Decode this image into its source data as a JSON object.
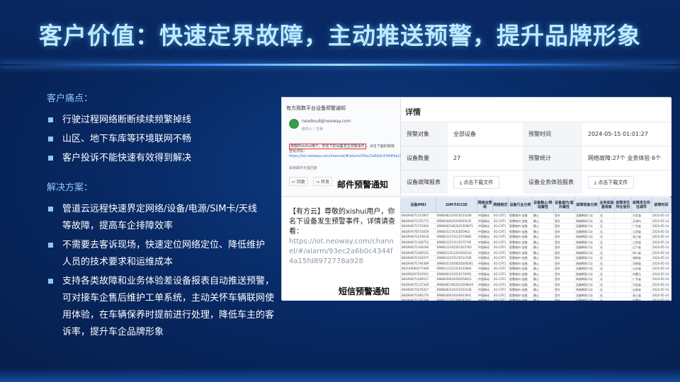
{
  "slide": {
    "title": "客户价值：快速定界故障，主动推送预警，提升品牌形象"
  },
  "pain_points": {
    "heading": "客户痛点：",
    "items": [
      {
        "text": "行驶过程网络断断续续频繁掉线"
      },
      {
        "text": "山区、地下车库等环境联网不畅"
      },
      {
        "text": "客户投诉不能快速有效得到解决"
      }
    ]
  },
  "solutions": {
    "heading": "解决方案：",
    "items": [
      {
        "text": "管道云远程快速界定网络/设备/电源/SIM卡/天线",
        "cont": "等故障，提高车企排障效率"
      },
      {
        "text": "不需要去客诉现场，快速定位网络定位、降低维护",
        "cont": "人员的技术要求和运维成本"
      },
      {
        "text": "支持各类故障和业务体验差设备报表自动推送预警，",
        "cont": "可对接车企售后维护工单系统，主动关怀车辆联网使用体验，在车辆保养时提前进行处理，降低车主的客诉率，提升车企品牌形象"
      }
    ]
  },
  "figure": {
    "email": {
      "title": "有方观数平台设备预警通知",
      "from": "neodoud@neoway.com",
      "to": "收件人：王伊",
      "highlight": "尊敬的xishui用户，你名下的设备发生预警事件",
      "body_rest": "，点击下面的链接查看详情：",
      "link": "https://iot.neoway.com/channel/#/alarm/93ec2a6b0c4344f4a15fd8972778a928",
      "footer": "系统邮件无需回复",
      "btn_reply": "回复",
      "btn_forward": "转发",
      "caption": "邮件预警通知"
    },
    "details": {
      "title": "详情",
      "rows": [
        {
          "l1": "预警对象",
          "v1": "全部设备",
          "l2": "预警时间",
          "v2": "2024-05-15 01:01:27"
        },
        {
          "l1": "设备数量",
          "v1": "27",
          "l2": "预警统计",
          "v2": "网络故障:27个  业务体验 6个"
        },
        {
          "l1": "设备故障报表",
          "v1": "点击下载文件",
          "l2": "设备业务体验报表",
          "v2": "点击下载文件"
        }
      ]
    },
    "sms": {
      "text": "【有方云】尊敬的xishui用户，你名下设备发生预警事件，详情请查看：",
      "link": "https://iot.neoway.com/channel/#/alarm/93ec2a6b0c4344f4a15fd8972778a928",
      "caption": "短信预警通知"
    },
    "table": {
      "headers": [
        "设备IMEI",
        "SIM卡ICCID",
        "网络运营商",
        "网络制式",
        "设备行业分类",
        "设备静止/移动属性",
        "设备室内/室外属性",
        "故障现象分类",
        "业务体验差现象",
        "故障发生所在省份",
        "故障发生所在城市",
        "故障时间"
      ],
      "rows": [
        [
          "864094071313907",
          "89860823192C0521638",
          "中国移动",
          "4G-CAT1",
          "智慧城市-金融",
          "静止",
          "室外",
          "设备断网:1次",
          "无",
          "",
          "河北省",
          "2024-05-14"
        ],
        [
          "864094071355772",
          "89860484192A0920235",
          "中国移动",
          "4G-CAT1",
          "智慧城市-金融",
          "静止",
          "室外",
          "网络断网:1次",
          "无",
          "",
          "天津市",
          "2024-05-14"
        ],
        [
          "864094071715004",
          "89860823462025509875",
          "中国移动",
          "4G-CAT1",
          "智慧城市-金融",
          "静止",
          "室外",
          "设备断网:1次",
          "无",
          "",
          "广东省",
          "2024-05-14"
        ],
        [
          "864097078753059",
          "89860321743CB50962",
          "中国移动",
          "4G-CAT1",
          "智慧城市-金融",
          "静止",
          "室外",
          "设备断网:1次",
          "无",
          "",
          "江西省",
          "2024-05-14"
        ],
        [
          "864094071219618",
          "89860123741C0570882",
          "中国移动",
          "4G-CAT1",
          "智慧城市-金融",
          "静止",
          "室外",
          "网络断网:1次",
          "无",
          "",
          "浙江省",
          "2024-05-14"
        ],
        [
          "864094071306753",
          "89860123741C0575795",
          "中国移动",
          "4G-CAT1",
          "智慧城市-金融",
          "静止",
          "室外",
          "网络断网:1次",
          "无",
          "",
          "江苏省",
          "2024-05-14"
        ],
        [
          "864094071300296",
          "89860123452D1025783",
          "中国移动",
          "4G-CAT1",
          "智慧城市-金融",
          "静止",
          "室外",
          "设备断网:1次",
          "无",
          "",
          "辽宁省",
          "2024-05-14"
        ],
        [
          "864094071360531",
          "89860123C22A1001524",
          "中国移动",
          "4G-CAT1",
          "智慧城市-金融",
          "静止",
          "室外",
          "网络断网:1次",
          "无",
          "",
          "四川省",
          "2024-05-14"
        ],
        [
          "864094071301975",
          "89860123741C0514728",
          "中国移动",
          "4G-CAT1",
          "智慧城市-金融",
          "静止",
          "室外",
          "设备断网:1次",
          "无",
          "",
          "湖南省",
          "2024-05-14"
        ],
        [
          "864094071794389",
          "89860321456626508281",
          "中国移动",
          "4G-CAT1",
          "智慧城市-金融",
          "静止",
          "室外",
          "网络断网:1次",
          "无",
          "",
          "河南省",
          "2024-05-14"
        ],
        [
          "862140060377499",
          "89861123212C0410864",
          "中国移动",
          "4G-CAT1",
          "智慧城市-金融",
          "静止",
          "室外",
          "设备断网:1次",
          "无",
          "",
          "山东省",
          "2024-05-14"
        ],
        [
          "864090207619501",
          "89860812192C0170955",
          "中国移动",
          "4G-CAT1",
          "智慧城市-金融",
          "静止",
          "室外",
          "网络断网:1次",
          "无",
          "",
          "内蒙古",
          "2024-05-14"
        ],
        [
          "864094071469527",
          "89860394192D0556652",
          "中国移动",
          "4G-CAT1",
          "智慧城市-金融",
          "静止",
          "室外",
          "网络断网:1次",
          "无",
          "",
          "广东省",
          "2024-05-14"
        ],
        [
          "864094071137349",
          "89860823462025508929",
          "中国移动",
          "4G-CAT1",
          "智慧城市-金融",
          "静止",
          "室外",
          "设备断网:1次",
          "无",
          "",
          "河北省",
          "2024-05-14"
        ],
        [
          "864094071076327",
          "89860823192C0521638",
          "中国移动",
          "4G-CAT1",
          "智慧城市-金融",
          "静止",
          "室外",
          "网络断网:1次",
          "无",
          "",
          "吉林省",
          "2024-05-14"
        ],
        [
          "864094071485270",
          "89860484192A0923901",
          "中国移动",
          "4G-CAT1",
          "智慧城市-金融",
          "静止",
          "室外",
          "设备断网:1次",
          "无",
          "",
          "浙江省",
          "2024-05-14"
        ],
        [
          "864094071356389",
          "89861123212B0097062",
          "中国移动",
          "4G-CAT1",
          "智慧城市-金融",
          "静止",
          "室外",
          "设备断网:1次",
          "无",
          "",
          "内蒙古",
          "2024-05-14"
        ]
      ]
    }
  },
  "colors": {
    "title_glow": "#bfe9ff",
    "accent": "#8fc6ff",
    "line_glow": "#3d8bff"
  }
}
